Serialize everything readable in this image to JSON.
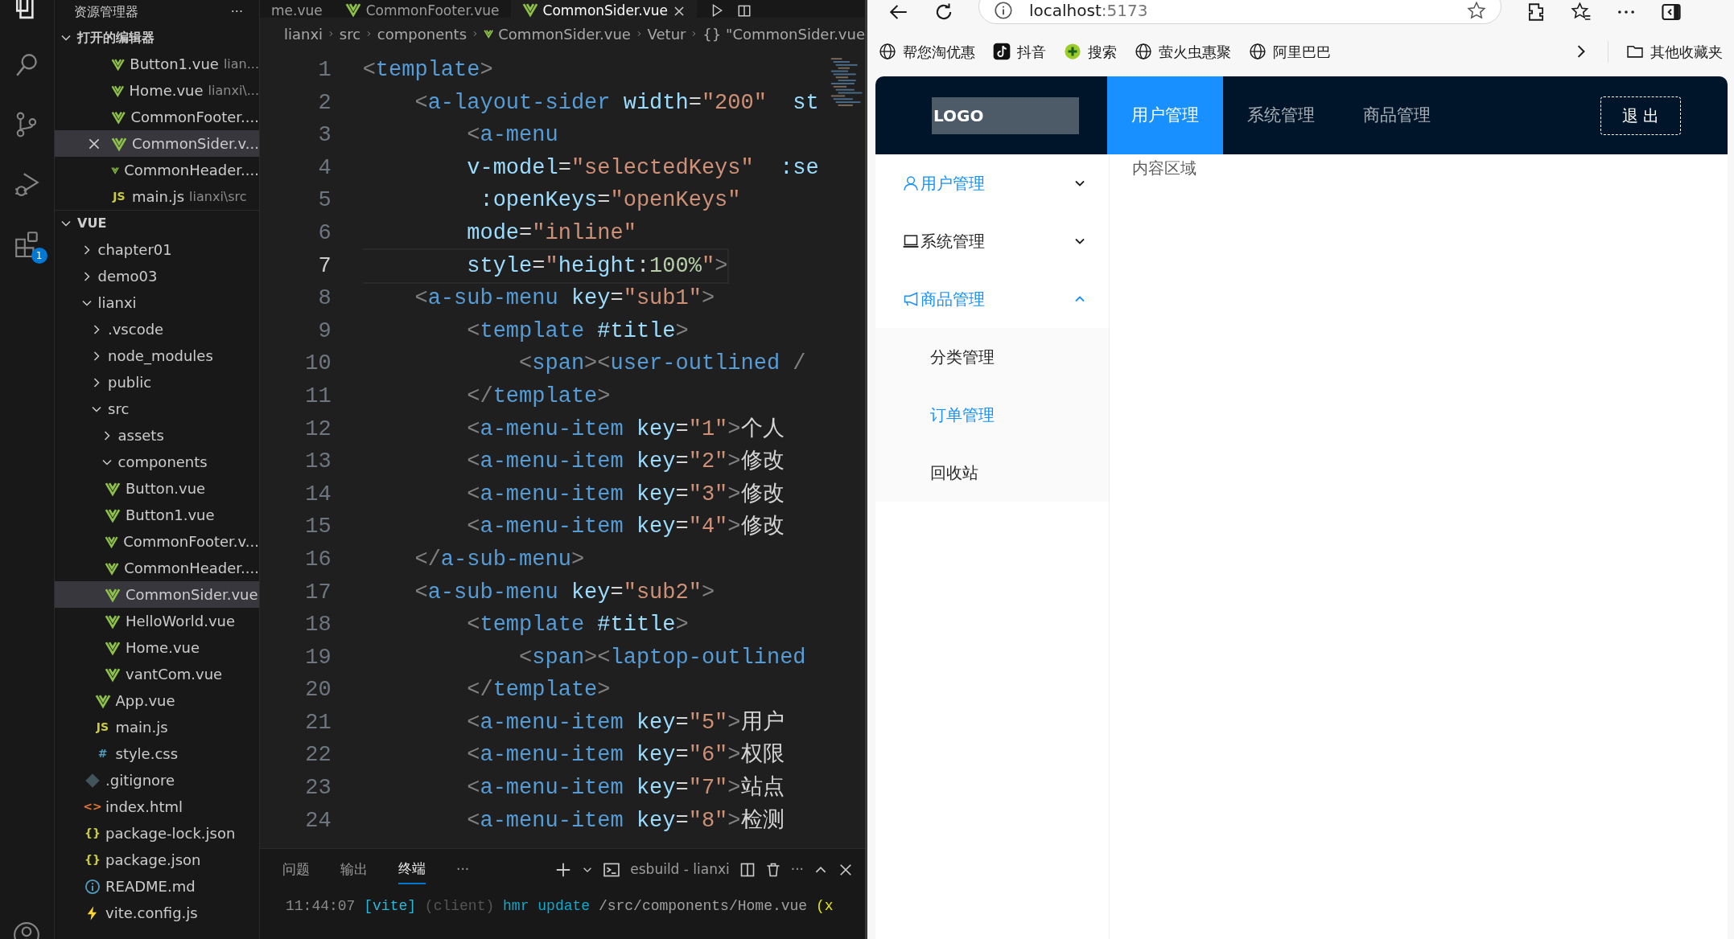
{
  "activity_bar": {
    "items": [
      {
        "kind": "files",
        "selected": true
      },
      {
        "kind": "search",
        "selected": false
      },
      {
        "kind": "source-control",
        "selected": false
      },
      {
        "kind": "run-debug",
        "selected": false
      },
      {
        "kind": "extensions",
        "selected": false,
        "badge": "1"
      }
    ]
  },
  "explorer": {
    "title": "资源管理器",
    "more": "···",
    "open_editors": {
      "label": "打开的编辑器",
      "expanded": true,
      "items": [
        {
          "name": "Button1.vue",
          "description": "lian...",
          "kind": "vue",
          "selected": false
        },
        {
          "name": "Home.vue",
          "description": "lianxi\\...",
          "kind": "vue",
          "selected": false
        },
        {
          "name": "CommonFooter....",
          "kind": "vue",
          "selected": false
        },
        {
          "name": "CommonSider.v...",
          "kind": "vue",
          "selected": true
        },
        {
          "name": "CommonHeader....",
          "kind": "vue",
          "selected": false
        },
        {
          "name": "main.js",
          "description": "lianxi\\src",
          "kind": "js",
          "glyph": "JS",
          "selected": false
        }
      ]
    },
    "workspace": {
      "label": "VUE",
      "expanded": true,
      "children": [
        {
          "name": "chapter01",
          "kind": "folder",
          "expanded": false,
          "selected": false
        },
        {
          "name": "demo03",
          "kind": "folder",
          "expanded": false,
          "selected": false
        },
        {
          "name": "lianxi",
          "kind": "folder",
          "expanded": true,
          "selected": false,
          "children": [
            {
              "name": ".vscode",
              "kind": "folder",
              "expanded": false,
              "selected": false
            },
            {
              "name": "node_modules",
              "kind": "folder",
              "expanded": false,
              "selected": false
            },
            {
              "name": "public",
              "kind": "folder",
              "expanded": false,
              "selected": false
            },
            {
              "name": "src",
              "kind": "folder",
              "expanded": true,
              "selected": false,
              "children": [
                {
                  "name": "assets",
                  "kind": "folder",
                  "expanded": false,
                  "selected": false
                },
                {
                  "name": "components",
                  "kind": "folder",
                  "expanded": true,
                  "selected": false,
                  "children": [
                    {
                      "name": "Button.vue",
                      "kind": "vue",
                      "selected": false
                    },
                    {
                      "name": "Button1.vue",
                      "kind": "vue",
                      "selected": false
                    },
                    {
                      "name": "CommonFooter.v...",
                      "kind": "vue",
                      "selected": false
                    },
                    {
                      "name": "CommonHeader....",
                      "kind": "vue",
                      "selected": false
                    },
                    {
                      "name": "CommonSider.vue",
                      "kind": "vue",
                      "selected": true
                    },
                    {
                      "name": "HelloWorld.vue",
                      "kind": "vue",
                      "selected": false
                    },
                    {
                      "name": "Home.vue",
                      "kind": "vue",
                      "selected": false
                    },
                    {
                      "name": "vantCom.vue",
                      "kind": "vue",
                      "selected": false
                    }
                  ]
                },
                {
                  "name": "App.vue",
                  "kind": "vue",
                  "selected": false
                },
                {
                  "name": "main.js",
                  "kind": "js",
                  "glyph": "JS",
                  "selected": false
                },
                {
                  "name": "style.css",
                  "kind": "css",
                  "glyph": "#",
                  "selected": false
                }
              ]
            },
            {
              "name": ".gitignore",
              "kind": "git",
              "selected": false
            },
            {
              "name": "index.html",
              "kind": "html",
              "glyph": "<>",
              "selected": false
            },
            {
              "name": "package-lock.json",
              "kind": "json",
              "glyph": "{}",
              "selected": false
            },
            {
              "name": "package.json",
              "kind": "json",
              "glyph": "{}",
              "selected": false
            },
            {
              "name": "README.md",
              "kind": "info",
              "selected": false
            },
            {
              "name": "vite.config.js",
              "kind": "vite",
              "selected": false
            }
          ]
        }
      ]
    }
  },
  "editor": {
    "tabs": [
      {
        "label": "me.vue",
        "kind": "plain",
        "selected": false
      },
      {
        "label": "CommonFooter.vue",
        "kind": "vue",
        "selected": false
      },
      {
        "label": "CommonSider.vue",
        "kind": "vue",
        "selected": true
      }
    ],
    "breadcrumb": [
      {
        "label": "lianxi",
        "kind": "plain"
      },
      {
        "label": "src",
        "kind": "plain"
      },
      {
        "label": "components",
        "kind": "plain"
      },
      {
        "label": "CommonSider.vue",
        "kind": "vue"
      },
      {
        "label": "Vetur",
        "kind": "plain"
      },
      {
        "label": "\"CommonSider.vue",
        "kind": "glyph",
        "glyph": "{}"
      }
    ],
    "lines": [
      {
        "number": "1",
        "current": false,
        "tokens": [
          {
            "kind": "punct",
            "text": "<"
          },
          {
            "kind": "tag",
            "text": "template"
          },
          {
            "kind": "punct",
            "text": ">"
          }
        ]
      },
      {
        "number": "2",
        "current": false,
        "tokens": [
          {
            "kind": "punct",
            "text": "    <"
          },
          {
            "kind": "tag",
            "text": "a-layout-sider"
          },
          {
            "kind": "attr",
            "text": " width"
          },
          {
            "kind": "plain",
            "text": "="
          },
          {
            "kind": "string",
            "text": "\"200\""
          },
          {
            "kind": "attr",
            "text": "  st"
          }
        ]
      },
      {
        "number": "3",
        "current": false,
        "tokens": [
          {
            "kind": "punct",
            "text": "        <"
          },
          {
            "kind": "tag",
            "text": "a-menu"
          }
        ]
      },
      {
        "number": "4",
        "current": false,
        "tokens": [
          {
            "kind": "attr",
            "text": "        v-model"
          },
          {
            "kind": "plain",
            "text": "="
          },
          {
            "kind": "string",
            "text": "\"selectedKeys\""
          },
          {
            "kind": "attr",
            "text": "  :se"
          }
        ]
      },
      {
        "number": "5",
        "current": false,
        "tokens": [
          {
            "kind": "attr",
            "text": "         :openKeys"
          },
          {
            "kind": "plain",
            "text": "="
          },
          {
            "kind": "string",
            "text": "\"openKeys\""
          }
        ]
      },
      {
        "number": "6",
        "current": false,
        "tokens": [
          {
            "kind": "attr",
            "text": "        mode"
          },
          {
            "kind": "plain",
            "text": "="
          },
          {
            "kind": "string",
            "text": "\"inline\""
          }
        ]
      },
      {
        "number": "7",
        "current": true,
        "tokens": [
          {
            "kind": "attr",
            "text": "        style"
          },
          {
            "kind": "plain",
            "text": "="
          },
          {
            "kind": "string",
            "text": "\""
          },
          {
            "kind": "attr",
            "text": "height"
          },
          {
            "kind": "plain",
            "text": ":"
          },
          {
            "kind": "number",
            "text": "100%"
          },
          {
            "kind": "string",
            "text": "\""
          },
          {
            "kind": "punct",
            "text": ">"
          }
        ]
      },
      {
        "number": "8",
        "current": false,
        "tokens": [
          {
            "kind": "punct",
            "text": "    <"
          },
          {
            "kind": "tag",
            "text": "a-sub-menu"
          },
          {
            "kind": "attr",
            "text": " key"
          },
          {
            "kind": "plain",
            "text": "="
          },
          {
            "kind": "string",
            "text": "\"sub1\""
          },
          {
            "kind": "punct",
            "text": ">"
          }
        ]
      },
      {
        "number": "9",
        "current": false,
        "tokens": [
          {
            "kind": "punct",
            "text": "        <"
          },
          {
            "kind": "tag",
            "text": "template"
          },
          {
            "kind": "attr",
            "text": " #title"
          },
          {
            "kind": "punct",
            "text": ">"
          }
        ]
      },
      {
        "number": "10",
        "current": false,
        "tokens": [
          {
            "kind": "punct",
            "text": "            <"
          },
          {
            "kind": "tag",
            "text": "span"
          },
          {
            "kind": "punct",
            "text": "><"
          },
          {
            "kind": "tag",
            "text": "user-outlined"
          },
          {
            "kind": "punct",
            "text": " /"
          }
        ]
      },
      {
        "number": "11",
        "current": false,
        "tokens": [
          {
            "kind": "punct",
            "text": "        </"
          },
          {
            "kind": "tag",
            "text": "template"
          },
          {
            "kind": "punct",
            "text": ">"
          }
        ]
      },
      {
        "number": "12",
        "current": false,
        "tokens": [
          {
            "kind": "punct",
            "text": "        <"
          },
          {
            "kind": "tag",
            "text": "a-menu-item"
          },
          {
            "kind": "attr",
            "text": " key"
          },
          {
            "kind": "plain",
            "text": "="
          },
          {
            "kind": "string",
            "text": "\"1\""
          },
          {
            "kind": "punct",
            "text": ">"
          },
          {
            "kind": "plain",
            "text": "个人"
          }
        ]
      },
      {
        "number": "13",
        "current": false,
        "tokens": [
          {
            "kind": "punct",
            "text": "        <"
          },
          {
            "kind": "tag",
            "text": "a-menu-item"
          },
          {
            "kind": "attr",
            "text": " key"
          },
          {
            "kind": "plain",
            "text": "="
          },
          {
            "kind": "string",
            "text": "\"2\""
          },
          {
            "kind": "punct",
            "text": ">"
          },
          {
            "kind": "plain",
            "text": "修改"
          }
        ]
      },
      {
        "number": "14",
        "current": false,
        "tokens": [
          {
            "kind": "punct",
            "text": "        <"
          },
          {
            "kind": "tag",
            "text": "a-menu-item"
          },
          {
            "kind": "attr",
            "text": " key"
          },
          {
            "kind": "plain",
            "text": "="
          },
          {
            "kind": "string",
            "text": "\"3\""
          },
          {
            "kind": "punct",
            "text": ">"
          },
          {
            "kind": "plain",
            "text": "修改"
          }
        ]
      },
      {
        "number": "15",
        "current": false,
        "tokens": [
          {
            "kind": "punct",
            "text": "        <"
          },
          {
            "kind": "tag",
            "text": "a-menu-item"
          },
          {
            "kind": "attr",
            "text": " key"
          },
          {
            "kind": "plain",
            "text": "="
          },
          {
            "kind": "string",
            "text": "\"4\""
          },
          {
            "kind": "punct",
            "text": ">"
          },
          {
            "kind": "plain",
            "text": "修改"
          }
        ]
      },
      {
        "number": "16",
        "current": false,
        "tokens": [
          {
            "kind": "punct",
            "text": "    </"
          },
          {
            "kind": "tag",
            "text": "a-sub-menu"
          },
          {
            "kind": "punct",
            "text": ">"
          }
        ]
      },
      {
        "number": "17",
        "current": false,
        "tokens": [
          {
            "kind": "punct",
            "text": "    <"
          },
          {
            "kind": "tag",
            "text": "a-sub-menu"
          },
          {
            "kind": "attr",
            "text": " key"
          },
          {
            "kind": "plain",
            "text": "="
          },
          {
            "kind": "string",
            "text": "\"sub2\""
          },
          {
            "kind": "punct",
            "text": ">"
          }
        ]
      },
      {
        "number": "18",
        "current": false,
        "tokens": [
          {
            "kind": "punct",
            "text": "        <"
          },
          {
            "kind": "tag",
            "text": "template"
          },
          {
            "kind": "attr",
            "text": " #title"
          },
          {
            "kind": "punct",
            "text": ">"
          }
        ]
      },
      {
        "number": "19",
        "current": false,
        "tokens": [
          {
            "kind": "punct",
            "text": "            <"
          },
          {
            "kind": "tag",
            "text": "span"
          },
          {
            "kind": "punct",
            "text": "><"
          },
          {
            "kind": "tag",
            "text": "laptop-outlined"
          }
        ]
      },
      {
        "number": "20",
        "current": false,
        "tokens": [
          {
            "kind": "punct",
            "text": "        </"
          },
          {
            "kind": "tag",
            "text": "template"
          },
          {
            "kind": "punct",
            "text": ">"
          }
        ]
      },
      {
        "number": "21",
        "current": false,
        "tokens": [
          {
            "kind": "punct",
            "text": "        <"
          },
          {
            "kind": "tag",
            "text": "a-menu-item"
          },
          {
            "kind": "attr",
            "text": " key"
          },
          {
            "kind": "plain",
            "text": "="
          },
          {
            "kind": "string",
            "text": "\"5\""
          },
          {
            "kind": "punct",
            "text": ">"
          },
          {
            "kind": "plain",
            "text": "用户"
          }
        ]
      },
      {
        "number": "22",
        "current": false,
        "tokens": [
          {
            "kind": "punct",
            "text": "        <"
          },
          {
            "kind": "tag",
            "text": "a-menu-item"
          },
          {
            "kind": "attr",
            "text": " key"
          },
          {
            "kind": "plain",
            "text": "="
          },
          {
            "kind": "string",
            "text": "\"6\""
          },
          {
            "kind": "punct",
            "text": ">"
          },
          {
            "kind": "plain",
            "text": "权限"
          }
        ]
      },
      {
        "number": "23",
        "current": false,
        "tokens": [
          {
            "kind": "punct",
            "text": "        <"
          },
          {
            "kind": "tag",
            "text": "a-menu-item"
          },
          {
            "kind": "attr",
            "text": " key"
          },
          {
            "kind": "plain",
            "text": "="
          },
          {
            "kind": "string",
            "text": "\"7\""
          },
          {
            "kind": "punct",
            "text": ">"
          },
          {
            "kind": "plain",
            "text": "站点"
          }
        ]
      },
      {
        "number": "24",
        "current": false,
        "tokens": [
          {
            "kind": "punct",
            "text": "        <"
          },
          {
            "kind": "tag",
            "text": "a-menu-item"
          },
          {
            "kind": "attr",
            "text": " key"
          },
          {
            "kind": "plain",
            "text": "="
          },
          {
            "kind": "string",
            "text": "\"8\""
          },
          {
            "kind": "punct",
            "text": ">"
          },
          {
            "kind": "plain",
            "text": "检测"
          }
        ]
      }
    ]
  },
  "panel": {
    "tabs": [
      {
        "label": "问题",
        "selected": false
      },
      {
        "label": "输出",
        "selected": false
      },
      {
        "label": "终端",
        "selected": true
      }
    ],
    "tabs_more": "···",
    "terminal_name": "esbuild - lianxi",
    "actions_more": "···",
    "terminal": [
      {
        "tokens": [
          {
            "kind": "time",
            "text": "11:44:07"
          },
          {
            "kind": "source",
            "text": " [vite]"
          },
          {
            "kind": "dim",
            "text": " (client)"
          },
          {
            "kind": "event",
            "text": " hmr update"
          },
          {
            "kind": "path",
            "text": " /src/components/Home.vue"
          },
          {
            "kind": "count",
            "text": " (x"
          }
        ]
      }
    ]
  },
  "browser": {
    "address": {
      "host": "localhost",
      "port": ":5173"
    },
    "bookmarks": [
      {
        "label": "帮您淘优惠",
        "kind": "globe"
      },
      {
        "label": "抖音",
        "kind": "note"
      },
      {
        "label": "搜索",
        "kind": "plus"
      },
      {
        "label": "萤火虫惠聚",
        "kind": "globe"
      },
      {
        "label": "阿里巴巴",
        "kind": "globe"
      }
    ],
    "other_bookmarks": "其他收藏夹",
    "page": {
      "logo": "LOGO",
      "nav": [
        {
          "label": "用户管理",
          "selected": true
        },
        {
          "label": "系统管理",
          "selected": false
        },
        {
          "label": "商品管理",
          "selected": false
        }
      ],
      "logout": "退 出",
      "menu": [
        {
          "label": "用户管理",
          "kind": "user",
          "highlighted": true,
          "expanded": false
        },
        {
          "label": "系统管理",
          "kind": "laptop",
          "highlighted": false,
          "expanded": false
        },
        {
          "label": "商品管理",
          "kind": "notification",
          "highlighted": true,
          "expanded": true,
          "children": [
            {
              "label": "分类管理",
              "highlighted": false
            },
            {
              "label": "订单管理",
              "highlighted": true
            },
            {
              "label": "回收站",
              "highlighted": false
            }
          ]
        }
      ],
      "content": "内容区域"
    }
  }
}
